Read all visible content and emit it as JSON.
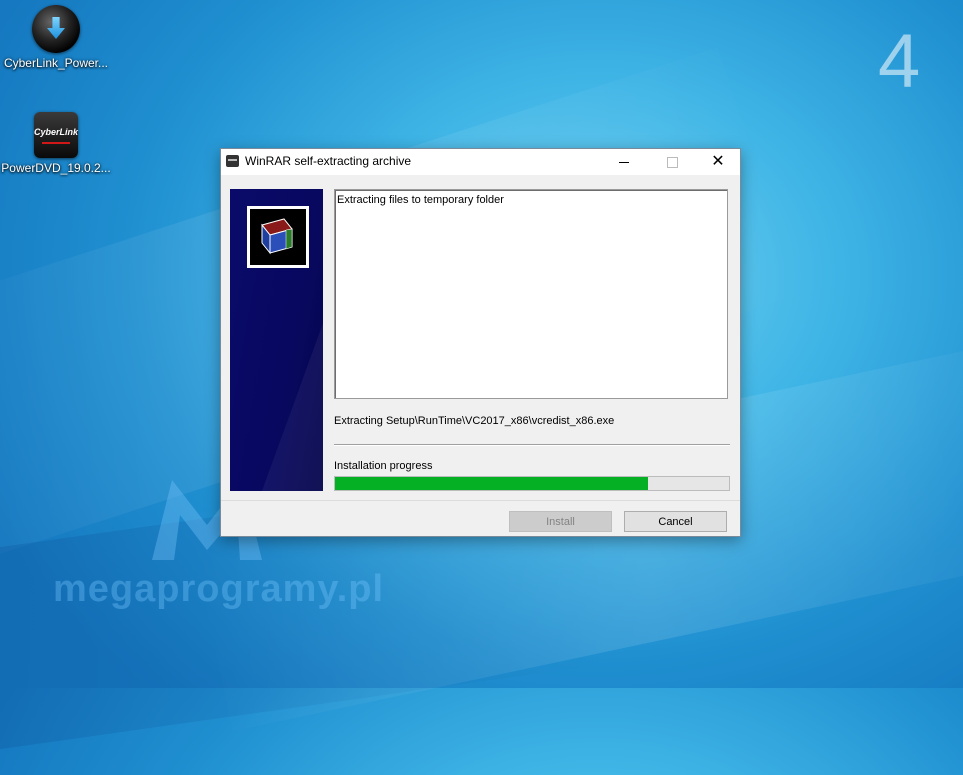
{
  "desktop": {
    "icons": [
      {
        "label": "CyberLink_Power..."
      },
      {
        "label": "PowerDVD_19.0.2...",
        "badge_text": "CyberLink"
      }
    ],
    "corner_number": "4",
    "watermark": "megaprogramy.pl"
  },
  "window": {
    "title": "WinRAR self-extracting archive",
    "log_text": "Extracting files to temporary folder",
    "current_file": "Extracting Setup\\RunTime\\VC2017_x86\\vcredist_x86.exe",
    "progress_label": "Installation progress",
    "progress_fraction": 0.795,
    "install_label": "Install",
    "cancel_label": "Cancel",
    "colors": {
      "progress": "#06b025",
      "sidebar": "#0a0a6a"
    }
  }
}
